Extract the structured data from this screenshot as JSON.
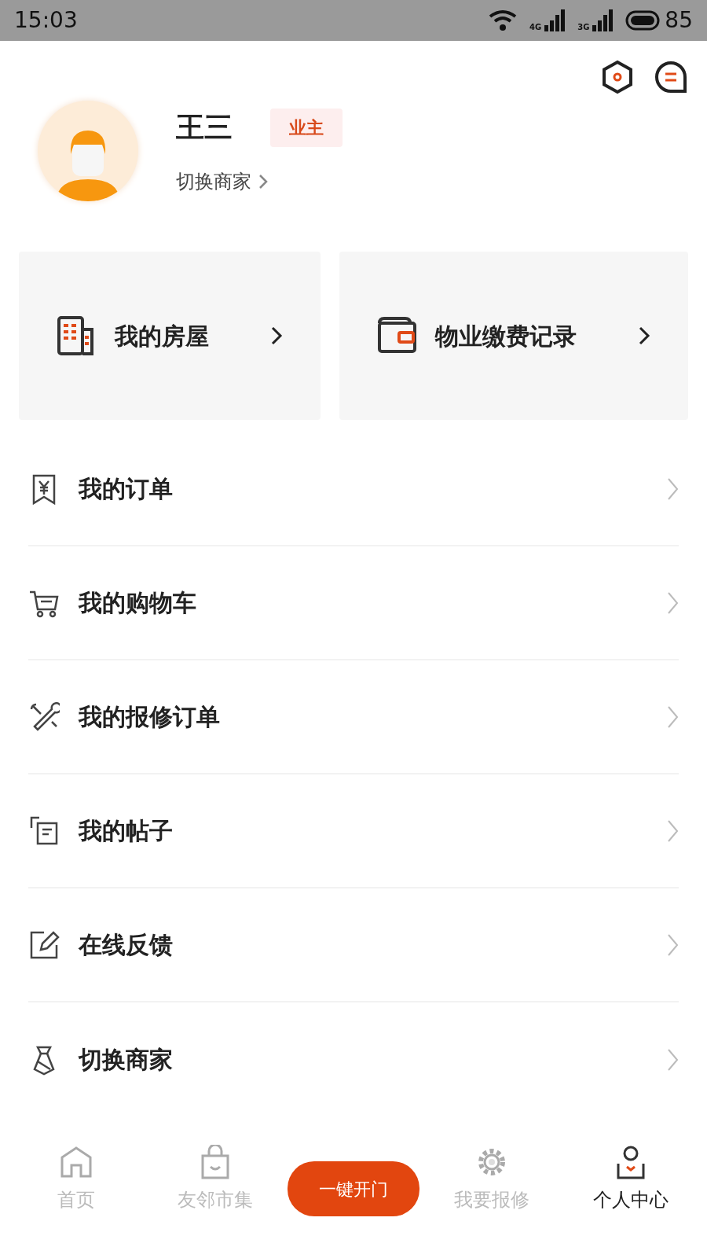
{
  "status_bar": {
    "time": "15:03",
    "networks": [
      "4G",
      "3G"
    ],
    "battery": "85"
  },
  "profile": {
    "name": "王三",
    "role_badge": "业主",
    "switch_link": "切换商家"
  },
  "cards": [
    {
      "kind": "house",
      "label": "我的房屋"
    },
    {
      "kind": "wallet",
      "label": "物业缴费记录"
    }
  ],
  "menu": [
    {
      "kind": "order",
      "label": "我的订单"
    },
    {
      "kind": "cart",
      "label": "我的购物车"
    },
    {
      "kind": "repair",
      "label": "我的报修订单"
    },
    {
      "kind": "post",
      "label": "我的帖子"
    },
    {
      "kind": "feedback",
      "label": "在线反馈"
    },
    {
      "kind": "merchant",
      "label": "切换商家"
    }
  ],
  "bottom_nav": {
    "tabs": [
      {
        "kind": "home",
        "label": "首页",
        "selected": false
      },
      {
        "kind": "market",
        "label": "友邻市集",
        "selected": false
      },
      {
        "kind": "door",
        "label": "一键开门",
        "selected": false
      },
      {
        "kind": "repair",
        "label": "我要报修",
        "selected": false
      },
      {
        "kind": "user",
        "label": "个人中心",
        "selected": true
      }
    ]
  }
}
